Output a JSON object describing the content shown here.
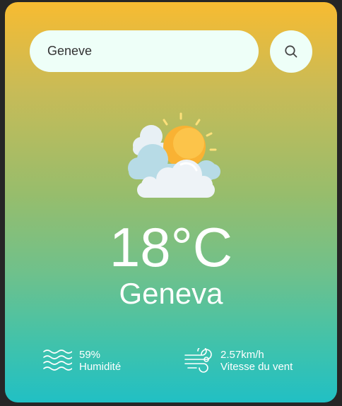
{
  "search": {
    "value": "Geneve",
    "placeholder": ""
  },
  "weather": {
    "icon": "partly-cloudy-sun-icon",
    "temperature": "18°C",
    "city": "Geneva"
  },
  "details": {
    "humidity": {
      "value": "59%",
      "label": "Humidité",
      "icon": "humidity-waves-icon"
    },
    "wind": {
      "value": "2.57km/h",
      "label": "Vitesse du vent",
      "icon": "wind-icon"
    }
  },
  "colors": {
    "gradient_top": "#f7bb31",
    "gradient_bottom": "#21c0c4",
    "search_bg": "#eefff8",
    "text": "#ffffff"
  }
}
